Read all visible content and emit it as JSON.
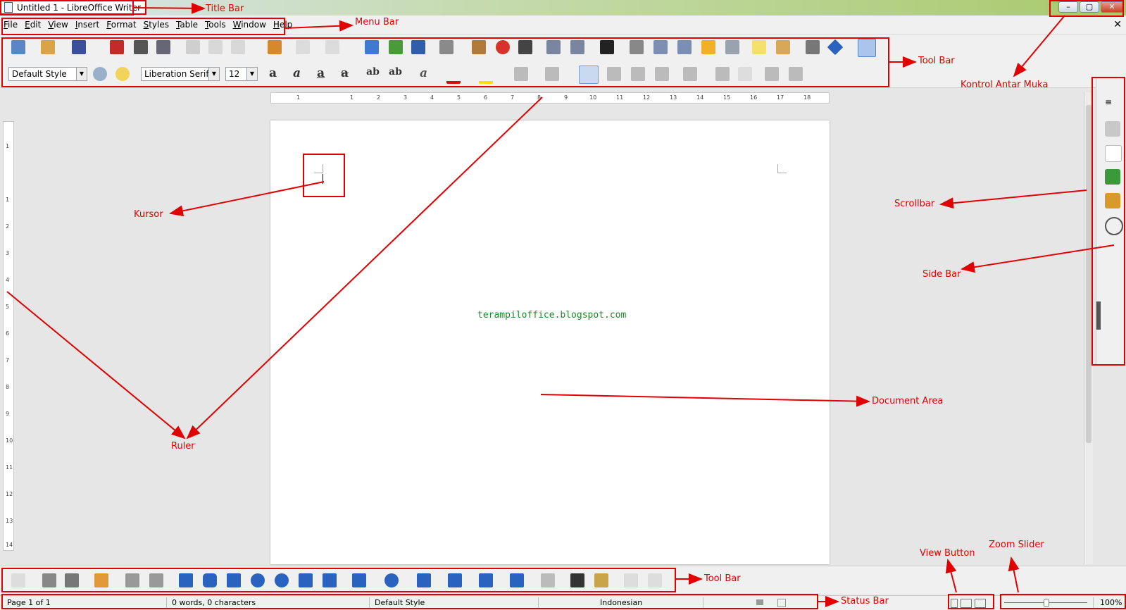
{
  "window": {
    "title": "Untitled 1 - LibreOffice Writer",
    "controls": [
      "–",
      "▢",
      "✕"
    ]
  },
  "menu": [
    "File",
    "Edit",
    "View",
    "Insert",
    "Format",
    "Styles",
    "Table",
    "Tools",
    "Window",
    "Help"
  ],
  "doc_close": "✕",
  "formatting": {
    "paragraph_style": "Default Style",
    "font_name": "Liberation Serif",
    "font_size": "12"
  },
  "ruler_h": [
    "1",
    "1",
    "2",
    "3",
    "4",
    "5",
    "6",
    "7",
    "8",
    "9",
    "10",
    "11",
    "12",
    "13",
    "14",
    "15",
    "16",
    "17",
    "18"
  ],
  "ruler_v": [
    "1",
    "1",
    "2",
    "3",
    "4",
    "5",
    "6",
    "7",
    "8",
    "9",
    "10",
    "11",
    "12",
    "13",
    "14"
  ],
  "document": {
    "watermark": "terampiloffice.blogspot.com"
  },
  "status": {
    "page": "Page 1 of 1",
    "words": "0 words, 0 characters",
    "style": "Default Style",
    "language": "Indonesian",
    "zoom": "100%"
  },
  "annotations": {
    "title_bar": "Title Bar",
    "menu_bar": "Menu Bar",
    "tool_bar_top": "Tool Bar",
    "kontrol": "Kontrol Antar Muka",
    "kursor": "Kursor",
    "scrollbar": "Scrollbar",
    "side_bar": "Side Bar",
    "ruler": "Ruler",
    "document_area": "Document Area",
    "tool_bar_bottom": "Tool Bar",
    "status_bar": "Status Bar",
    "view_button": "View Button",
    "zoom_slider": "Zoom Slider"
  },
  "colors": {
    "annotation": "#e10000",
    "watermark": "#1a8a2a",
    "toolbar": "#f0f0f0"
  }
}
